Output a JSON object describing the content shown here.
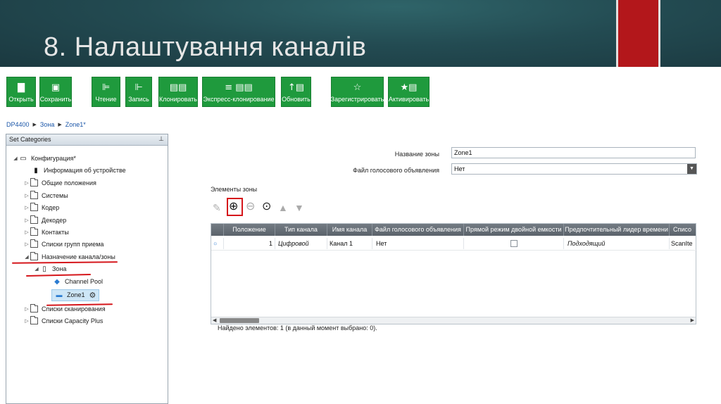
{
  "slide": {
    "title": "8. Налаштування каналів",
    "accent_color": "#b3171b",
    "header_bg": "#234b52"
  },
  "toolbar": {
    "buttons": [
      {
        "label": "Открыть",
        "icon": "folder-open-icon"
      },
      {
        "label": "Сохранить",
        "icon": "save-icon"
      },
      {
        "label": "Чтение",
        "icon": "read-icon"
      },
      {
        "label": "Запись",
        "icon": "write-icon"
      },
      {
        "label": "Клонировать",
        "icon": "clone-icon"
      },
      {
        "label": "Экспресс-клонирование",
        "icon": "express-clone-icon"
      },
      {
        "label": "Обновить",
        "icon": "update-icon"
      },
      {
        "label": "Зарегистрировать",
        "icon": "star-icon"
      },
      {
        "label": "Активировать",
        "icon": "activate-icon"
      }
    ],
    "button_color": "#1f9a3d"
  },
  "breadcrumb": [
    "DP4400",
    "Зона",
    "Zone1*"
  ],
  "left_panel": {
    "title": "Set Categories",
    "tree": [
      "Конфигурация*",
      "Информация об устройстве",
      "Общие положения",
      "Системы",
      "Кодер",
      "Декодер",
      "Контакты",
      "Списки групп приема",
      "Назначение канала/зоны",
      "Зона",
      "Channel Pool",
      "Zone1",
      "Списки сканирования",
      "Списки Capacity Plus"
    ]
  },
  "form": {
    "zone_name_label": "Название зоны",
    "zone_name_value": "Zone1",
    "voice_file_label": "Файл голосового объявления",
    "voice_file_value": "Нет"
  },
  "zone_elements": {
    "title": "Элементы зоны",
    "columns": [
      "Положение",
      "Тип канала",
      "Имя канала",
      "Файл голосового объявления",
      "Прямой режим двойной емкости",
      "Предпочтительный лидер времени",
      "Списо"
    ],
    "rows": [
      {
        "position": "1",
        "type": "Цифровой",
        "name": "Канал 1",
        "voice_file": "Нет",
        "direct_mode": false,
        "time_leader": "Подходящий",
        "list": "ScanIte"
      }
    ],
    "status": "Найдено элементов: 1 (в данный момент выбрано: 0)."
  },
  "annotation_color": "#d5161b"
}
